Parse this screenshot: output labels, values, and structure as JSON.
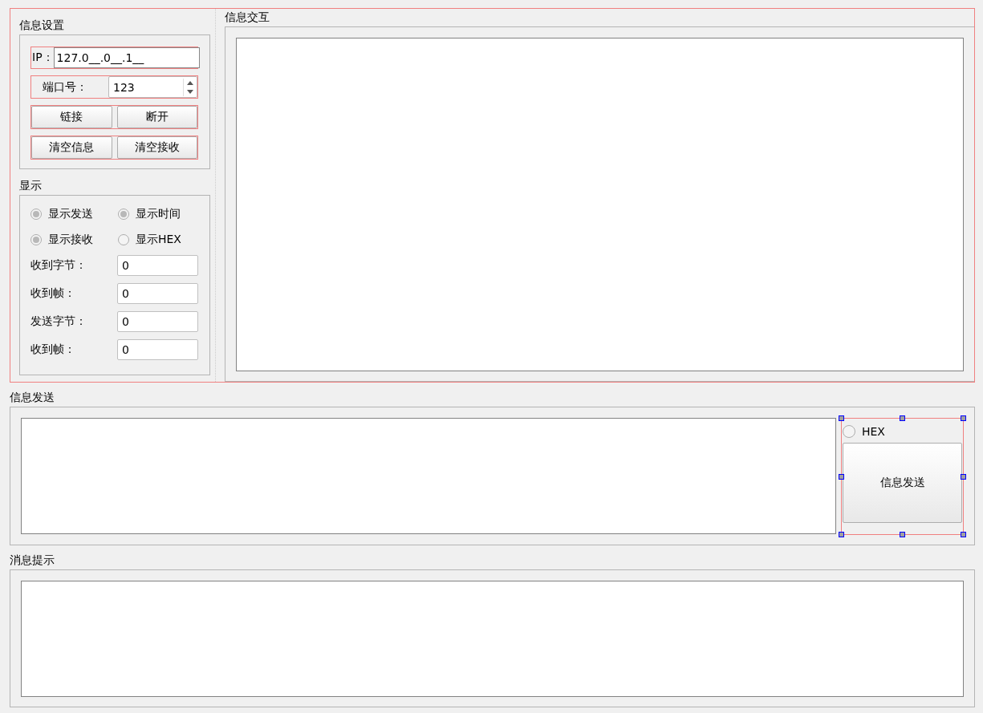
{
  "settings": {
    "title": "信息设置",
    "ip": {
      "label": "IP：",
      "value": "127.0__.0__.1__"
    },
    "port": {
      "label": "端口号：",
      "value": "123"
    },
    "buttons": [
      [
        "链接",
        "断开"
      ],
      [
        "清空信息",
        "清空接收"
      ]
    ]
  },
  "display": {
    "title": "显示",
    "options": [
      {
        "label": "显示发送",
        "checked": true
      },
      {
        "label": "显示时间",
        "checked": true
      },
      {
        "label": "显示接收",
        "checked": true
      },
      {
        "label": "显示HEX",
        "checked": false
      }
    ],
    "counters": [
      {
        "label": "收到字节：",
        "value": "0"
      },
      {
        "label": "收到帧：",
        "value": "0"
      },
      {
        "label": "发送字节：",
        "value": "0"
      },
      {
        "label": "收到帧：",
        "value": "0"
      }
    ]
  },
  "interaction": {
    "title": "信息交互"
  },
  "send": {
    "title": "信息发送",
    "hex": {
      "label": "HEX",
      "checked": false
    },
    "button": "信息发送"
  },
  "messages": {
    "title": "消息提示"
  }
}
